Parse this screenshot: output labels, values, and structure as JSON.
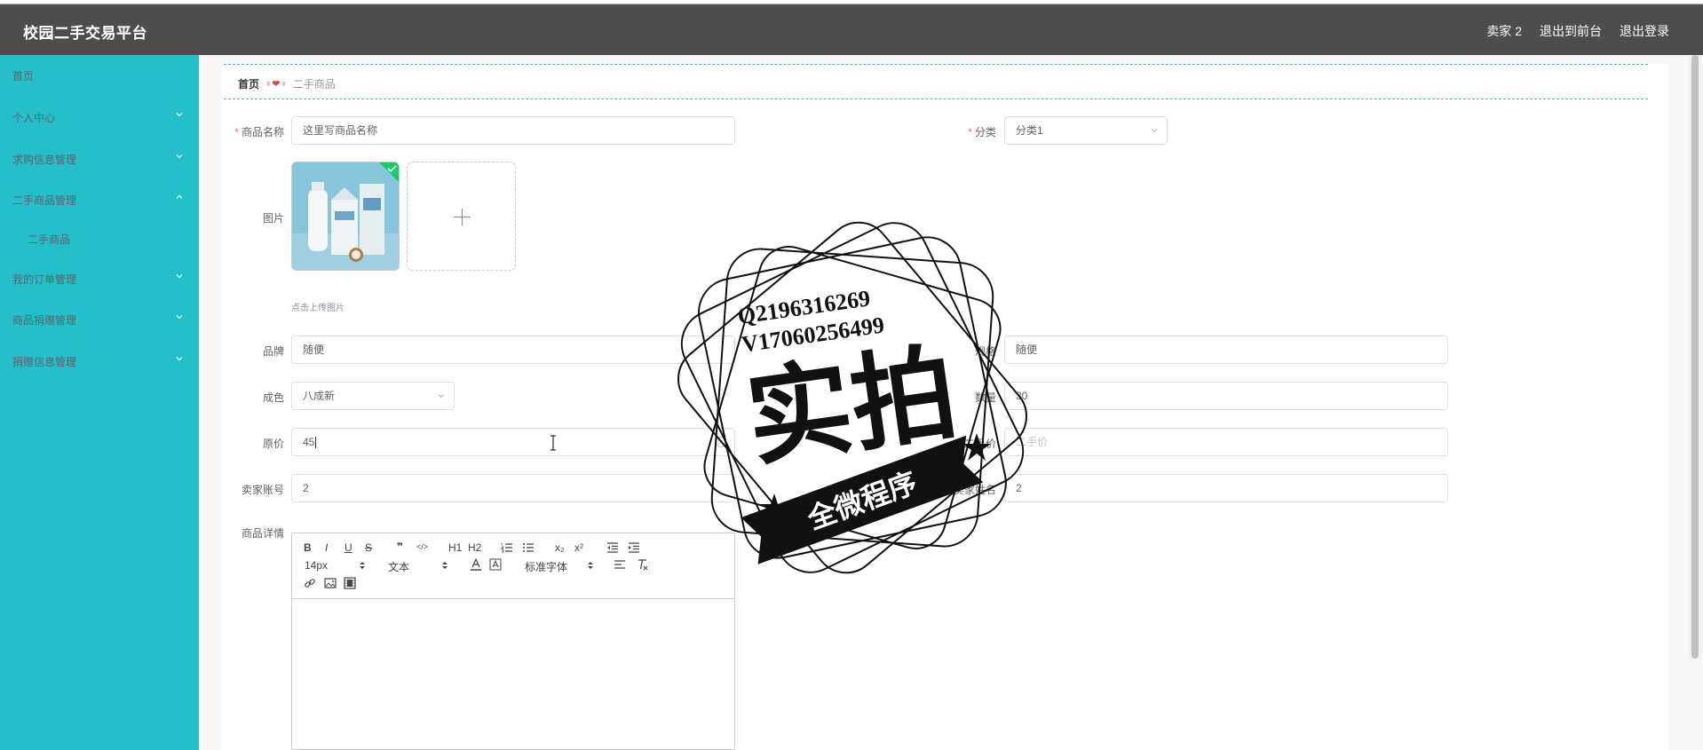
{
  "header": {
    "title": "校园二手交易平台",
    "user": "卖家 2",
    "back_to_front": "退出到前台",
    "logout": "退出登录"
  },
  "sidebar": {
    "items": [
      {
        "label": "首页",
        "expandable": false
      },
      {
        "label": "个人中心",
        "expandable": true
      },
      {
        "label": "求购信息管理",
        "expandable": true
      },
      {
        "label": "二手商品管理",
        "expandable": true,
        "expanded": true
      },
      {
        "label": "二手商品",
        "sub": true
      },
      {
        "label": "我的订单管理",
        "expandable": true
      },
      {
        "label": "商品捐赠管理",
        "expandable": true
      },
      {
        "label": "捐赠信息管理",
        "expandable": true
      }
    ]
  },
  "breadcrumb": {
    "home": "首页",
    "separator": "♀❤♀",
    "current": "二手商品"
  },
  "form": {
    "name_label": "商品名称",
    "name_value": "这里写商品名称",
    "category_label": "分类",
    "category_value": "分类1",
    "image_label": "图片",
    "upload_hint": "点击上传图片",
    "brand_label": "品牌",
    "brand_value": "随便",
    "spec_label": "规格",
    "spec_value": "随便",
    "condition_label": "成色",
    "condition_value": "八成新",
    "quantity_label": "数量",
    "quantity_value": "30",
    "original_price_label": "原价",
    "original_price_value": "45",
    "used_price_label": "二手价",
    "used_price_placeholder": "二手价",
    "seller_account_label": "卖家账号",
    "seller_account_value": "2",
    "seller_name_label": "卖家姓名",
    "seller_name_value": "2",
    "detail_label": "商品详情"
  },
  "editor": {
    "font_size": "14px",
    "block_type": "文本",
    "font_family": "标准字体",
    "buttons": [
      "B",
      "I",
      "U",
      "S",
      "❞",
      "</>",
      "H1",
      "H2",
      "ol",
      "ul",
      "x₂",
      "x²",
      "outdent",
      "indent"
    ]
  },
  "watermark": {
    "line1": "Q2196316269",
    "line2": "V17060256499",
    "main": "实拍",
    "banner": "全微程序"
  },
  "colors": {
    "header_bg": "#4d4d4d",
    "sidebar_bg": "#25bfcc",
    "required": "#f56c6c",
    "breadcrumb_border": "#34b8e0"
  }
}
